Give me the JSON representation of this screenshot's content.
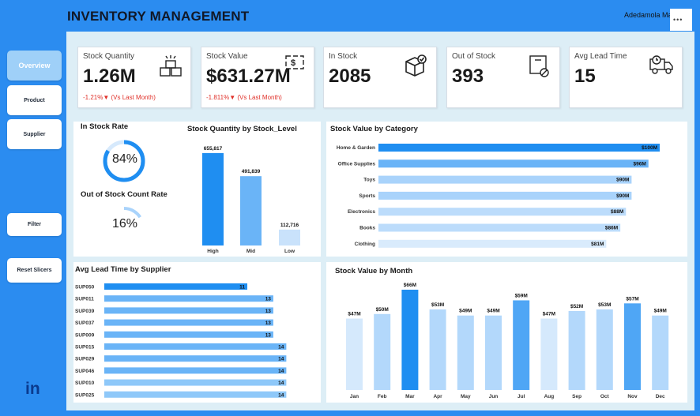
{
  "header": {
    "title": "INVENTORY MANAGEMENT",
    "user": "Adedamola Makinde"
  },
  "nav": {
    "overview": "Overview",
    "product": "Product",
    "supplier": "Supplier",
    "filter": "Filter",
    "reset": "Reset Slicers"
  },
  "kpis": [
    {
      "label": "Stock Quantity",
      "value": "1.26M",
      "delta": "-1.21%▼ (Vs Last Month)",
      "icon": "boxes-icon"
    },
    {
      "label": "Stock Value",
      "value": "$631.27M",
      "delta": "-1.811%▼ (Vs Last Month)",
      "icon": "money-icon"
    },
    {
      "label": "In Stock",
      "value": "2085",
      "icon": "box-check-icon"
    },
    {
      "label": "Out of Stock",
      "value": "393",
      "icon": "box-cancel-icon"
    },
    {
      "label": "Avg Lead Time",
      "value": "15",
      "icon": "truck-icon"
    }
  ],
  "rates": {
    "in_stock_title": "In Stock Rate",
    "in_stock_value": "84%",
    "in_stock_fraction": 0.84,
    "oos_title": "Out of Stock Count Rate",
    "oos_value": "16%",
    "oos_fraction": 0.16
  },
  "colors": {
    "accent": "#1f8ef1",
    "mid": "#6ab4f7",
    "light": "#c9e2fb",
    "delta_red": "#e0312a"
  },
  "chart_data": [
    {
      "type": "bar",
      "title": "Stock Quantity by Stock_Level",
      "categories": [
        "High",
        "Mid",
        "Low"
      ],
      "values": [
        655817,
        491839,
        112716
      ],
      "labels": [
        "655,817",
        "491,839",
        "112,716"
      ]
    },
    {
      "type": "bar",
      "orientation": "horizontal",
      "title": "Stock Value by Category",
      "categories": [
        "Home & Garden",
        "Office Supplies",
        "Toys",
        "Sports",
        "Electronics",
        "Books",
        "Clothing"
      ],
      "values": [
        100,
        96,
        90,
        90,
        88,
        86,
        81
      ],
      "labels": [
        "$100M",
        "$96M",
        "$90M",
        "$90M",
        "$88M",
        "$86M",
        "$81M"
      ]
    },
    {
      "type": "bar",
      "orientation": "horizontal",
      "title": "Avg Lead Time by Supplier",
      "categories": [
        "SUP050",
        "SUP011",
        "SUP039",
        "SUP037",
        "SUP009",
        "SUP015",
        "SUP029",
        "SUP046",
        "SUP010",
        "SUP025"
      ],
      "values": [
        11,
        13,
        13,
        13,
        13,
        14,
        14,
        14,
        14,
        14
      ],
      "labels": [
        "11",
        "13",
        "13",
        "13",
        "13",
        "14",
        "14",
        "14",
        "14",
        "14"
      ]
    },
    {
      "type": "bar",
      "title": "Stock Value by Month",
      "categories": [
        "Jan",
        "Feb",
        "Mar",
        "Apr",
        "May",
        "Jun",
        "Jul",
        "Aug",
        "Sep",
        "Oct",
        "Nov",
        "Dec"
      ],
      "values": [
        47,
        50,
        66,
        53,
        49,
        49,
        59,
        47,
        52,
        53,
        57,
        49
      ],
      "labels": [
        "$47M",
        "$50M",
        "$66M",
        "$53M",
        "$49M",
        "$49M",
        "$59M",
        "$47M",
        "$52M",
        "$53M",
        "$57M",
        "$49M"
      ]
    }
  ]
}
